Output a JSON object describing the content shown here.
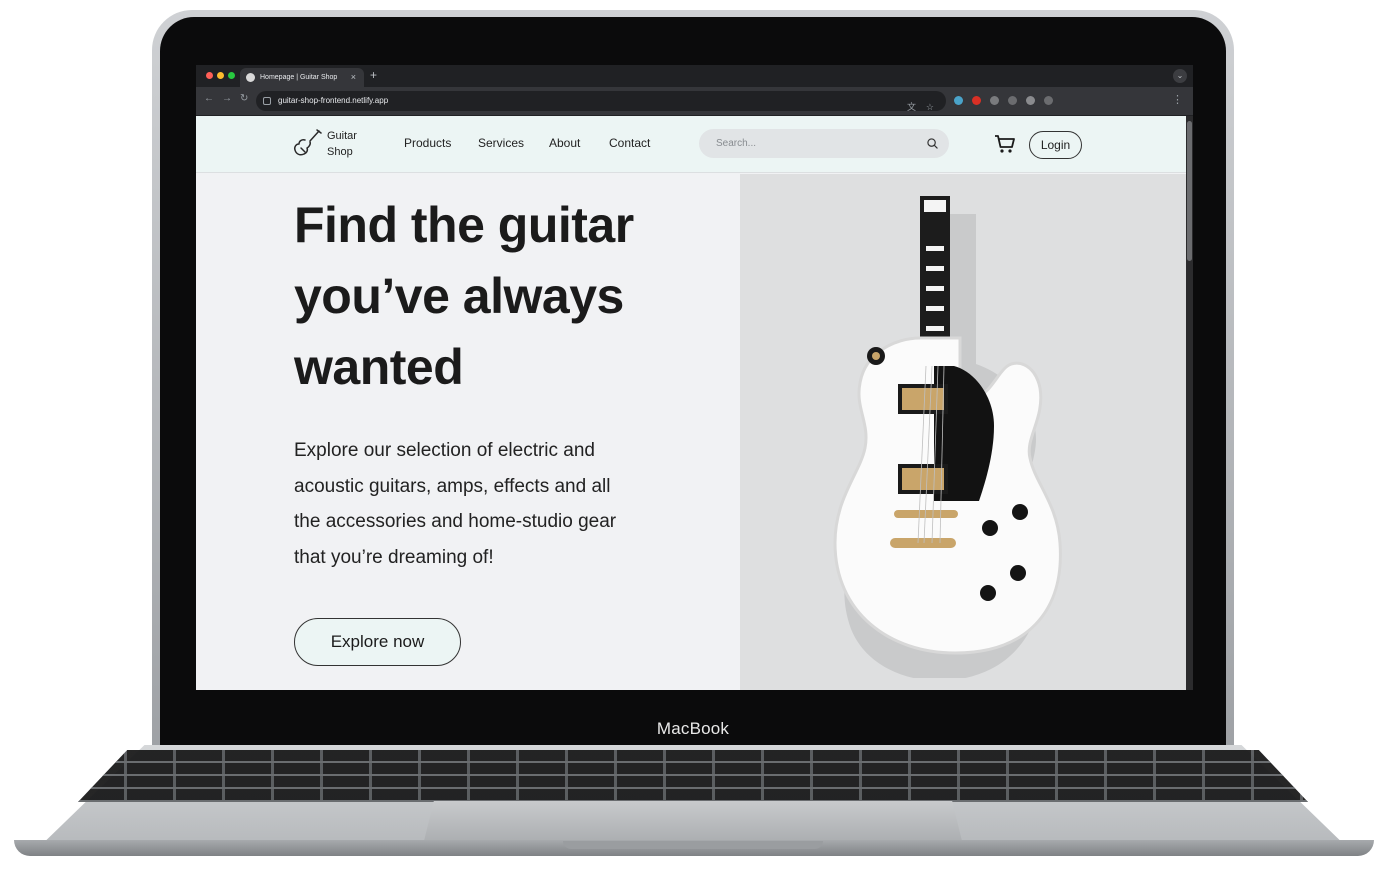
{
  "device": {
    "label": "MacBook"
  },
  "browser": {
    "tab_title": "Homepage | Guitar Shop",
    "tab_close": "×",
    "new_tab": "+",
    "url": "guitar-shop-frontend.netlify.app",
    "back": "←",
    "forward": "→",
    "reload": "↻",
    "menu": "⋮"
  },
  "site": {
    "brand": {
      "line1": "Guitar",
      "line2": "Shop",
      "icon": "guitar-icon"
    },
    "nav": [
      "Products",
      "Services",
      "About",
      "Contact"
    ],
    "search_placeholder": "Search...",
    "login_label": "Login",
    "hero": {
      "headline_lines": [
        "Find the guitar",
        "you’ve always",
        "wanted"
      ],
      "paragraph_lines": [
        "Explore our selection of electric and",
        "acoustic guitars, amps, effects and all",
        "the accessories and home-studio gear",
        "that you’re dreaming of!"
      ],
      "cta_label": "Explore now"
    }
  },
  "colors": {
    "accent_light": "#ecf5f4",
    "text_dark": "#1b1b1b",
    "browser_dark": "#202124"
  }
}
